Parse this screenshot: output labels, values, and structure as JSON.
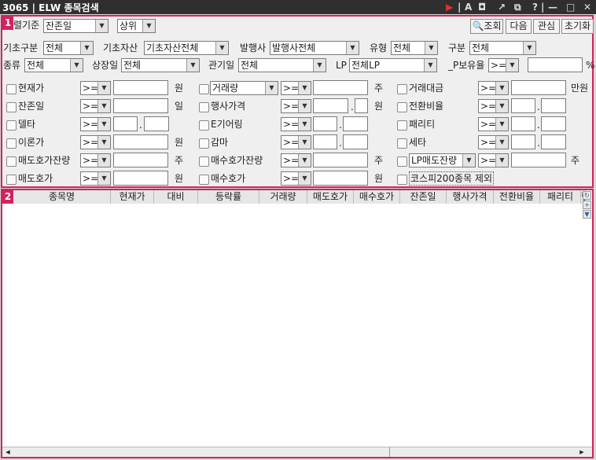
{
  "window": {
    "title": "3065 | ELW 종목검색",
    "toolbar_icons": [
      "play-icon",
      "font-icon",
      "bookmark-icon",
      "link-icon",
      "copy-icon",
      "help-icon",
      "minimize-icon",
      "maximize-icon",
      "close-icon"
    ]
  },
  "panel1": {
    "badge": "1",
    "row0": {
      "sort_label": "렬기준",
      "sort_value": "잔존일",
      "order_value": "상위",
      "buttons": {
        "search": "조회",
        "next": "다음",
        "interest": "관심",
        "reset": "초기화"
      }
    },
    "row1": {
      "base_type_label": "기초구분",
      "base_type_value": "전체",
      "base_asset_label": "기초자산",
      "base_asset_value": "기초자산전체",
      "issuer_label": "발행사",
      "issuer_value": "발행사전체",
      "type_label": "유형",
      "type_value": "전체",
      "division_label": "구분",
      "division_value": "전체"
    },
    "row2": {
      "kind_label": "종류",
      "kind_value": "전체",
      "listing_label": "상장일",
      "listing_value": "전체",
      "maturity_label": "관기일",
      "maturity_value": "전체",
      "lp_label": "LP",
      "lp_value": "전체LP",
      "lp_hold_label": "_P보유율",
      "lp_hold_op": ">=",
      "lp_hold_unit": "%"
    },
    "filters": {
      "col1": [
        {
          "label": "현재가",
          "op": ">=",
          "unit": "원"
        },
        {
          "label": "잔존일",
          "op": ">=",
          "unit": "일"
        },
        {
          "label": "델타",
          "op": ">=",
          "unit": ""
        },
        {
          "label": "이론가",
          "op": ">=",
          "unit": "원"
        },
        {
          "label": "매도호가잔량",
          "op": ">=",
          "unit": "주"
        },
        {
          "label": "매도호가",
          "op": ">=",
          "unit": "원"
        }
      ],
      "col2": [
        {
          "label": "거래량",
          "op": ">=",
          "unit": "주"
        },
        {
          "label": "행사가격",
          "op": ">=",
          "unit": "원"
        },
        {
          "label": "E기어링",
          "op": ">=",
          "unit": ""
        },
        {
          "label": "감마",
          "op": ">=",
          "unit": ""
        },
        {
          "label": "매수호가잔량",
          "op": ">=",
          "unit": "주"
        },
        {
          "label": "매수호가",
          "op": ">=",
          "unit": "원"
        }
      ],
      "col3": [
        {
          "label": "거래대금",
          "op": ">=",
          "unit": "만원"
        },
        {
          "label": "전환비율",
          "op": ">=",
          "unit": ""
        },
        {
          "label": "패리티",
          "op": ">=",
          "unit": ""
        },
        {
          "label": "세타",
          "op": ">=",
          "unit": ""
        },
        {
          "label": "LP매도잔량",
          "op": ">=",
          "unit": "주"
        },
        {
          "label": "코스피200종목 제외",
          "op": "",
          "unit": ""
        }
      ]
    }
  },
  "panel2": {
    "badge": "2",
    "columns": [
      "종목명",
      "현재가",
      "대비",
      "등락률",
      "거래량",
      "매도호가",
      "매수호가",
      "잔존일",
      "행사가격",
      "전환비율",
      "패리티",
      "행"
    ]
  }
}
